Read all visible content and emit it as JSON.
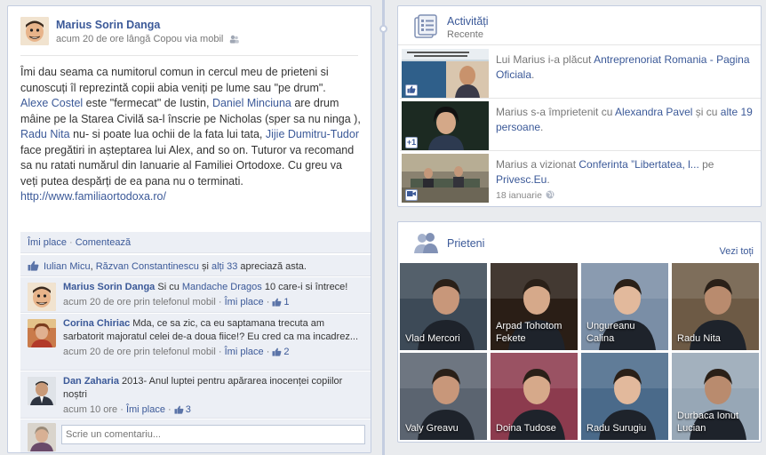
{
  "post": {
    "author": "Marius Sorin Danga",
    "meta": "acum 20 de ore lângă Copou via mobil",
    "text": {
      "p1": "Îmi dau seama ca numitorul comun in cercul meu de prieteni si cunoscuți îl reprezintă copii abia veniți pe lume sau \"pe drum\".",
      "mention1": "Alexe Costel",
      "p2": " este \"fermecat\" de Iustin, ",
      "mention2": "Daniel Minciuna",
      "p3": " are drum mâine pe la Starea Civilă sa-l înscrie pe Nicholas (sper sa nu ninga ), ",
      "mention3": "Radu Nita",
      "p4": " nu- si poate lua ochii de la fata lui tata, ",
      "mention4": "Jijie Dumitru-Tudor",
      "p5": " face pregătiri in așteptarea lui Alex, and so on. Tuturor va recomand sa nu ratati numărul din Ianuarie al Familiei Ortodoxe. Cu greu va veți putea despărți de ea pana nu o terminati. ",
      "link": "http://www.familiaortodoxa.ro/"
    },
    "actions": {
      "like": "Îmi place",
      "comment": "Comentează"
    },
    "likes": {
      "name1": "Iulian Micu",
      "sep1": ", ",
      "name2": "Răzvan Constantinescu",
      "sep2": " și ",
      "others": "alți 33",
      "suffix": " apreciază asta."
    },
    "comments": [
      {
        "author": "Marius Sorin Danga",
        "text_a": " Si cu ",
        "mention": "Mandache Dragos",
        "text_b": " 10 care-i si întrece!",
        "meta": "acum 20 de ore prin telefonul mobil",
        "like": "Îmi place",
        "count": "1"
      },
      {
        "author": "Corina Chiriac",
        "text": " Mda, ce sa zic, ca eu saptamana trecuta am sarbatorit majoratul celei de-a doua fiice!? Eu cred ca ma incadrez...",
        "meta": "acum 20 de ore prin telefonul mobil",
        "like": "Îmi place",
        "count": "2"
      },
      {
        "author": "Dan Zaharia",
        "text": " 2013- Anul luptei pentru apărarea inocenței copiilor noștri",
        "meta": "acum 10 ore",
        "like": "Îmi place",
        "count": "3"
      }
    ],
    "comment_placeholder": "Scrie un comentariu..."
  },
  "activity": {
    "title": "Activități",
    "subtitle": "Recente",
    "items": [
      {
        "prefix": "Lui Marius i-a plăcut ",
        "link": "Antreprenoriat Romania - Pagina Oficiala",
        "suffix": "."
      },
      {
        "prefix": "Marius s-a împrietenit cu ",
        "link": "Alexandra Pavel",
        "middle": " și cu ",
        "link2": "alte 19 persoane",
        "suffix": "."
      },
      {
        "prefix": "Marius a vizionat ",
        "link": "Conferinta ”Libertatea, l...",
        "middle": " pe ",
        "link2": "Privesc.Eu",
        "suffix": ".",
        "date": "18 ianuarie"
      }
    ],
    "badge2": "+1"
  },
  "friends": {
    "title": "Prieteni",
    "see_all": "Vezi toți",
    "list": [
      {
        "name": "Vlad Mercori",
        "color": "#3d4a57"
      },
      {
        "name": "Arpad Tohotom Fekete",
        "color": "#2a1e16"
      },
      {
        "name": "Ungureanu Calina",
        "color": "#7a8ea6"
      },
      {
        "name": "Radu Nita",
        "color": "#6d5a45"
      },
      {
        "name": "Valy Greavu",
        "color": "#5b6470"
      },
      {
        "name": "Doina Tudose",
        "color": "#8c3b4e"
      },
      {
        "name": "Radu Surugiu",
        "color": "#4a6a8a"
      },
      {
        "name": "Durbaca Ionut Lucian",
        "color": "#97a7b6"
      }
    ]
  },
  "colors": {
    "link": "#3b5998",
    "border": "#c4cde0",
    "panel": "#eceff5",
    "background": "#e9ebee"
  }
}
